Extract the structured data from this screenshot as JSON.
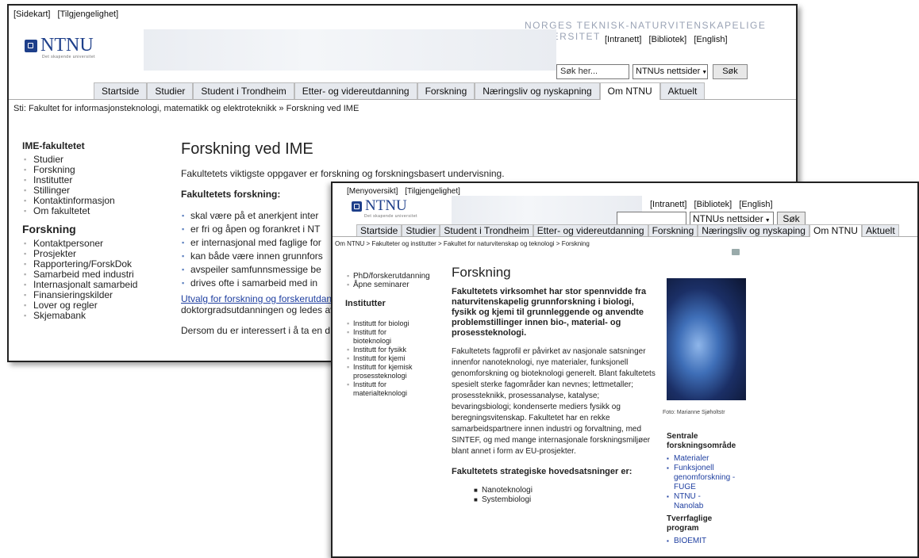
{
  "w1": {
    "top_links": [
      "[Sidekart]",
      "[Tilgjengelighet]"
    ],
    "university": "NORGES TEKNISK-NATURVITENSKAPELIGE UNIVERSITET",
    "logo": "NTNU",
    "tagline": "Det skapende universitet",
    "header_links": [
      "[Intranett]",
      "[Bibliotek]",
      "[English]"
    ],
    "search_placeholder": "Søk her...",
    "search_scope": "NTNUs nettsider",
    "search_button": "Søk",
    "nav": [
      "Startside",
      "Studier",
      "Student i Trondheim",
      "Etter- og videreutdanning",
      "Forskning",
      "Næringsliv og nyskapning",
      "Om NTNU",
      "Aktuelt"
    ],
    "active_tab": "Om NTNU",
    "breadcrumb": "Sti: Fakultet for informasjonsteknologi, matematikk og elektroteknikk » Forskning ved IME",
    "sidebar": {
      "heading1": "IME-fakultetet",
      "items1": [
        "Studier",
        "Forskning",
        "Institutter",
        "Stillinger",
        "Kontaktinformasjon",
        "Om fakultetet"
      ],
      "heading2": "Forskning",
      "items2": [
        "Kontaktpersoner",
        "Prosjekter",
        "Rapportering/ForskDok",
        "Samarbeid med industri",
        "Internasjonalt samarbeid",
        "Finansieringskilder",
        "Lover og regler",
        "Skjemabank"
      ]
    },
    "main": {
      "title": "Forskning ved IME",
      "intro": "Fakultetets viktigste oppgaver er forskning og forskningsbasert undervisning.",
      "subheading": "Fakultetets forskning:",
      "bullets": [
        "skal være på et anerkjent inter",
        "er fri og åpen og forankret i NT",
        "er internasjonal med faglige for",
        "kan både være innen grunnfors",
        "avspeiler samfunnsmessige be",
        "drives ofte i samarbeid med in"
      ],
      "link_text": "Utvalg for forskning og forskerutdann",
      "after_link": "doktorgradsutdanningen og ledes av",
      "last": "Dersom du er interessert i å ta en d"
    }
  },
  "w2": {
    "top_links": [
      "[Menyoversikt]",
      "[Tilgjengelighet]"
    ],
    "logo": "NTNU",
    "tagline": "Det skapende universitet",
    "header_links": [
      "[Intranett]",
      "[Bibliotek]",
      "[English]"
    ],
    "search_scope": "NTNUs nettsider",
    "search_button": "Søk",
    "nav": [
      "Startside",
      "Studier",
      "Student i Trondheim",
      "Etter- og videreutdanning",
      "Forskning",
      "Næringsliv og nyskaping",
      "Om NTNU",
      "Aktuelt"
    ],
    "active_tab": "Om NTNU",
    "breadcrumb": "Om NTNU > Fakulteter og institutter > Fakultet for naturvitenskap og teknologi > Forskning",
    "sidebar": {
      "items1": [
        "PhD/forskerutdanning",
        "Åpne seminarer"
      ],
      "heading": "Institutter",
      "items2": [
        "Institutt for biologi",
        "Institutt for bioteknologi",
        "Institutt for fysikk",
        "Institutt for kjemi",
        "Institutt for kjemisk prosessteknologi",
        "Institutt for materialteknologi"
      ]
    },
    "main": {
      "title": "Forskning",
      "lead": "Fakultetets virksomhet har stor spennvidde fra naturvitenskapelig grunnforskning i biologi, fysikk og kjemi til grunnleggende og anvendte problemstillinger innen bio-, material- og prosessteknologi.",
      "body": "Fakultetets fagprofil er påvirket av nasjonale satsninger innenfor nanoteknologi, nye materialer, funksjonell genomforskning og bioteknologi generelt. Blant fakultetets spesielt sterke fagområder kan nevnes; lettmetaller; prosessteknikk, prosessanalyse, katalyse; bevaringsbiologi; kondenserte mediers fysikk og beregningsvitenskap. Fakultetet har en rekke samarbeidspartnere innen industri og forvaltning, med SINTEF, og med mange internasjonale forskningsmiljøer blant annet i form av EU-prosjekter.",
      "strategic_heading": "Fakultetets strategiske hovedsatsninger er:",
      "strategic": [
        "Nanoteknologi",
        "Systembiologi"
      ]
    },
    "photo_caption": "Foto: Marianne Sjøholtstr",
    "box": {
      "heading1": "Sentrale forskningsområde",
      "items1": [
        "Materialer",
        "Funksjonell genomforskning - FUGE",
        "NTNU - Nanolab"
      ],
      "heading2": "Tverrfaglige program",
      "items2": [
        "BIOEMIT"
      ]
    }
  }
}
